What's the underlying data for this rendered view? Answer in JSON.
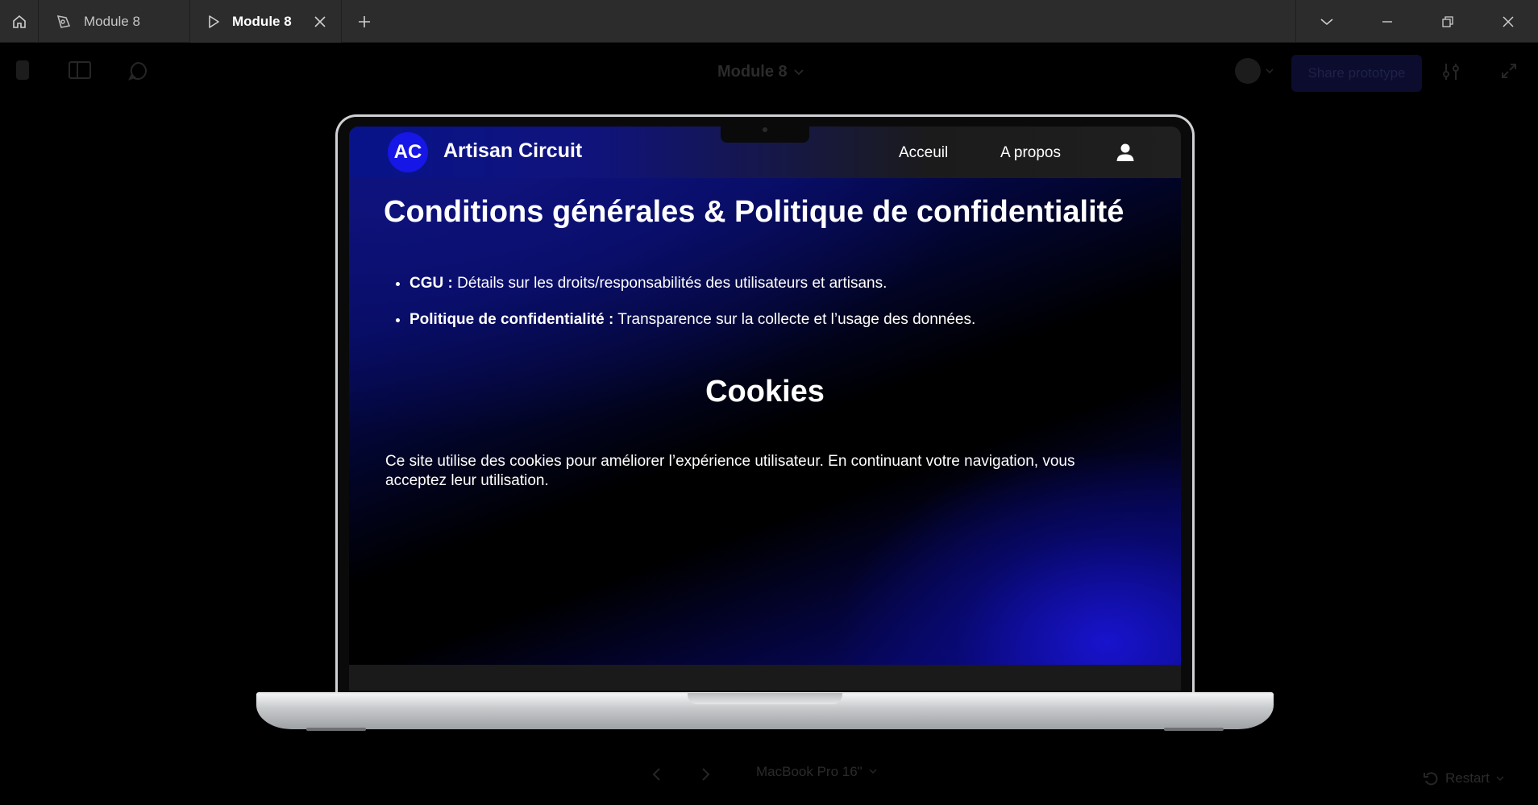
{
  "tabbar": {
    "tabs": [
      {
        "label": "Module 8",
        "icon": "design-file-icon",
        "active": false
      },
      {
        "label": "Module 8",
        "icon": "play-icon",
        "active": true
      }
    ]
  },
  "prototype": {
    "title": "Module 8",
    "share_label": "Share prototype",
    "device_label": "MacBook Pro 16\"",
    "restart_label": "Restart"
  },
  "site": {
    "logo": "AC",
    "brand": "Artisan Circuit",
    "nav": [
      "Acceuil",
      "A propos"
    ],
    "heading": "Conditions générales & Politique de confidentialité",
    "items": [
      {
        "term": "CGU :",
        "text": " Détails sur les droits/responsabilités des utilisateurs et artisans."
      },
      {
        "term": "Politique de confidentialité :",
        "text": " Transparence sur la collecte et l’usage des données."
      }
    ],
    "cookies_title": "Cookies",
    "cookies_text": "Ce site utilise des cookies pour améliorer l’expérience utilisateur. En continuant votre navigation, vous acceptez leur utilisation."
  },
  "colors": {
    "accent": "#1616e6",
    "tabbar": "#2c2c2c"
  }
}
